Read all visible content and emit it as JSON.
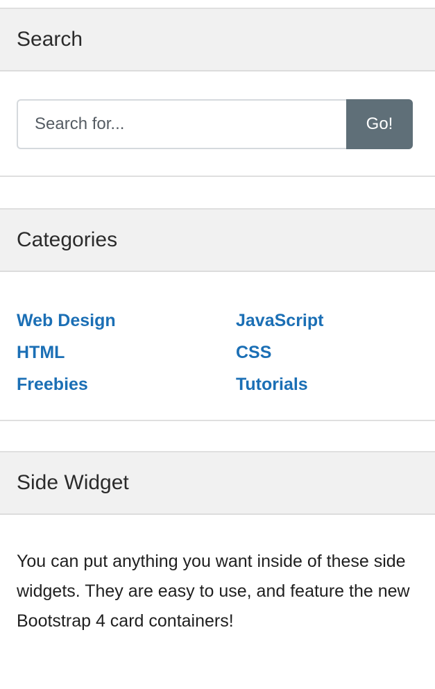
{
  "search": {
    "title": "Search",
    "placeholder": "Search for...",
    "button_label": "Go!"
  },
  "categories": {
    "title": "Categories",
    "left": [
      "Web Design",
      "HTML",
      "Freebies"
    ],
    "right": [
      "JavaScript",
      "CSS",
      "Tutorials"
    ]
  },
  "widget": {
    "title": "Side Widget",
    "text": "You can put anything you want inside of these side widgets. They are easy to use, and feature the new Bootstrap 4 card containers!"
  },
  "colors": {
    "link": "#1b6fb5",
    "button": "#5f6f78",
    "header_bg": "#f1f1f1"
  }
}
